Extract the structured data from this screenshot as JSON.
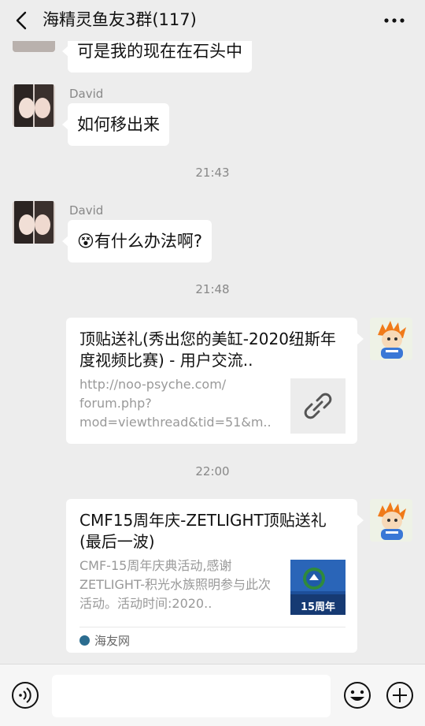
{
  "header": {
    "title": "海精灵鱼友3群(117)",
    "back_icon": "chevron-left-icon",
    "more_icon": "more-dots-icon"
  },
  "messages": [
    {
      "text": "可是我的现在在石头中"
    },
    {
      "sender": "David",
      "text": "如何移出来"
    },
    {
      "time": "21:43"
    },
    {
      "sender": "David",
      "emoji": "😵",
      "text": "有什么办法啊?"
    },
    {
      "time": "21:48"
    },
    {
      "card_title": "顶贴送礼(秀出您的美缸-2020纽斯年度视频比赛) - 用户交流..",
      "card_desc": "http://noo-psyche.com/\nforum.php?\nmod=viewthread&tid=51&m..",
      "thumb_icon": "link-icon"
    },
    {
      "time": "22:00"
    },
    {
      "card_title": "CMF15周年庆-ZETLIGHT顶贴送礼(最后一波)",
      "card_desc": "CMF-15周年庆典活动,感谢ZETLIGHT-积光水族照明参与此次活动。活动时间:2020..",
      "thumb_text": "15周年",
      "source": "海友网"
    }
  ],
  "bottombar": {
    "voice_icon": "voice-icon",
    "emoji_icon": "smile-icon",
    "plus_icon": "plus-icon"
  },
  "colors": {
    "background": "#ededed",
    "bubble": "#ffffff",
    "meta": "#888888"
  }
}
